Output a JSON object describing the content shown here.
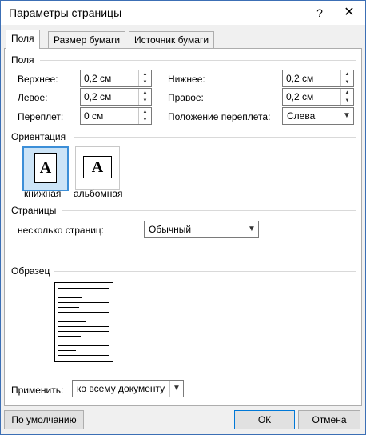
{
  "window": {
    "title": "Параметры страницы",
    "help_icon": "?",
    "close_icon": "✕"
  },
  "tabs": [
    {
      "label": "Поля",
      "active": true
    },
    {
      "label": "Размер бумаги",
      "active": false
    },
    {
      "label": "Источник бумаги",
      "active": false
    }
  ],
  "margins": {
    "section_label": "Поля",
    "top": {
      "label": "Верхнее:",
      "value": "0,2 см"
    },
    "bottom": {
      "label": "Нижнее:",
      "value": "0,2 см"
    },
    "left": {
      "label": "Левое:",
      "value": "0,2 см"
    },
    "right": {
      "label": "Правое:",
      "value": "0,2 см"
    },
    "gutter": {
      "label": "Переплет:",
      "value": "0 см"
    },
    "gutter_position": {
      "label": "Положение переплета:",
      "value": "Слева"
    }
  },
  "orientation": {
    "section_label": "Ориентация",
    "portrait": {
      "label": "книжная",
      "glyph": "A",
      "selected": true
    },
    "landscape": {
      "label": "альбомная",
      "glyph": "A",
      "selected": false
    }
  },
  "pages": {
    "section_label": "Страницы",
    "multiple_label": "несколько страниц:",
    "multiple_value": "Обычный"
  },
  "preview": {
    "section_label": "Образец"
  },
  "apply": {
    "label": "Применить:",
    "value": "ко всему документу"
  },
  "buttons": {
    "default_label": "По умолчанию",
    "ok_label": "ОК",
    "cancel_label": "Отмена"
  }
}
